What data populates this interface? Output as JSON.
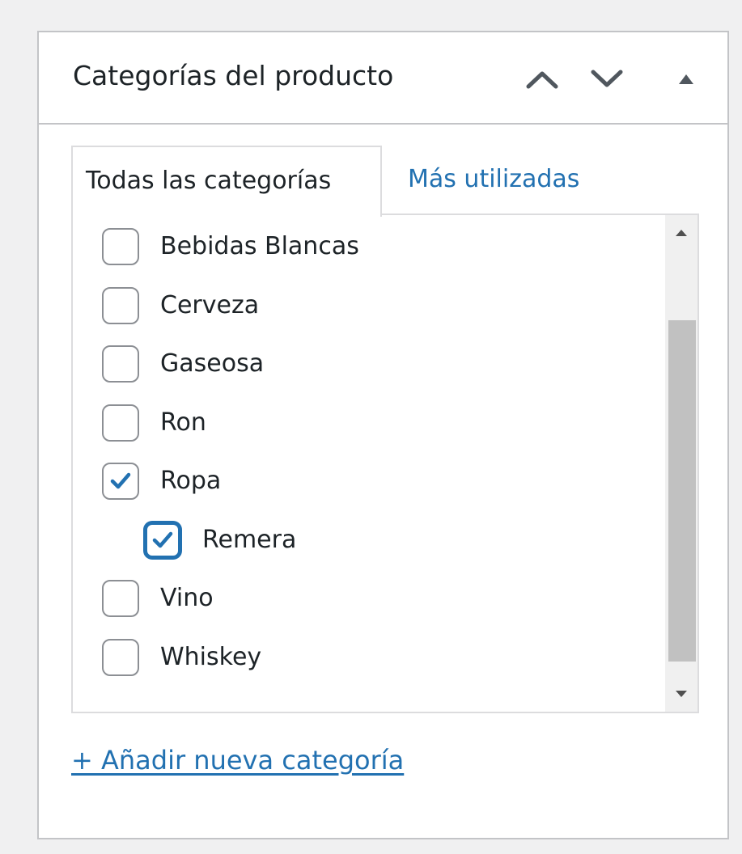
{
  "panel": {
    "title": "Categorías del producto",
    "move_up_icon": "chevron-up-icon",
    "move_down_icon": "chevron-down-icon",
    "toggle_icon": "triangle-up-icon"
  },
  "tabs": [
    {
      "label": "Todas las categorías",
      "active": true
    },
    {
      "label": "Más utilizadas",
      "active": false
    }
  ],
  "categories": [
    {
      "label": "Bebidas Blancas",
      "checked": false,
      "level": 0
    },
    {
      "label": "Cerveza",
      "checked": false,
      "level": 0
    },
    {
      "label": "Gaseosa",
      "checked": false,
      "level": 0
    },
    {
      "label": "Ron",
      "checked": false,
      "level": 0
    },
    {
      "label": "Ropa",
      "checked": true,
      "level": 0
    },
    {
      "label": "Remera",
      "checked": true,
      "level": 1,
      "focused": true
    },
    {
      "label": "Vino",
      "checked": false,
      "level": 0
    },
    {
      "label": "Whiskey",
      "checked": false,
      "level": 0
    }
  ],
  "add_new_link": "+ Añadir nueva categoría",
  "colors": {
    "accent": "#2271b1",
    "border": "#c3c4c7",
    "background": "#f0f0f1",
    "scroll_thumb": "#c1c1c1"
  }
}
